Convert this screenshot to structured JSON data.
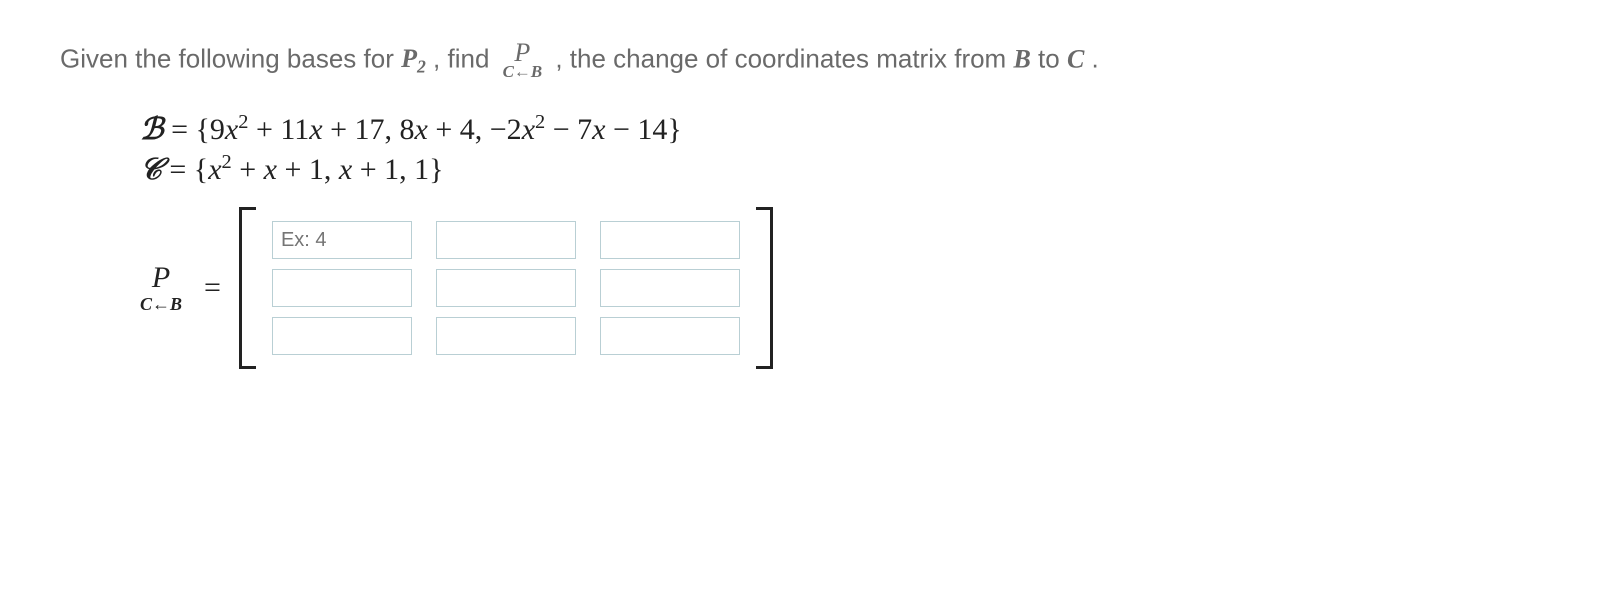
{
  "question": {
    "t1": "Given the following bases for ",
    "P2": "P",
    "P2_sub": "2",
    "t2": ", find ",
    "Psym": "P",
    "sub_left": "C",
    "sub_arrow": "←",
    "sub_right": "B",
    "t3": ", the change of coordinates matrix from ",
    "B": "B",
    "t4": " to ",
    "C": "C",
    "t5": "."
  },
  "bases": {
    "B_line": "ℬ = {9x² + 11x + 17, 8x + 4, −2x² − 7x − 14}",
    "C_line": "𝒞 = {x² + x + 1, x + 1, 1}"
  },
  "matrix": {
    "label_P": "P",
    "label_sub_left": "C",
    "label_sub_arrow": "←",
    "label_sub_right": "B",
    "equals": "=",
    "placeholder": "Ex: 4",
    "values": [
      "",
      "",
      "",
      "",
      "",
      "",
      "",
      "",
      ""
    ]
  }
}
